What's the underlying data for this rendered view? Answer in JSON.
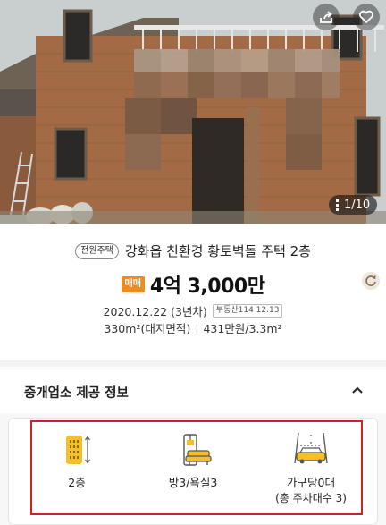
{
  "photo": {
    "counter": "1/10"
  },
  "listing": {
    "type_badge": "전원주택",
    "title": "강화읍 친환경 황토벽돌 주택 2층",
    "deal_badge": "매매",
    "price": "4억 3,000만",
    "date": "2020.12.22 (3년차)",
    "source_badge": "부동산114 12.13",
    "area_text": "330m²(대지면적)",
    "unit_price": "431만원/3.3m²"
  },
  "broker_section": {
    "title": "중개업소 제공 정보"
  },
  "features": [
    {
      "label": "2층",
      "icon": "building-floors-icon"
    },
    {
      "label": "방3/욕실3",
      "icon": "room-bath-icon"
    },
    {
      "label": "가구당0대",
      "sub": "(총 주차대수 3)",
      "icon": "parking-car-icon"
    }
  ],
  "colors": {
    "accent": "#f28a1e",
    "highlight": "#d21f26",
    "icon_yellow": "#f5bf28"
  }
}
